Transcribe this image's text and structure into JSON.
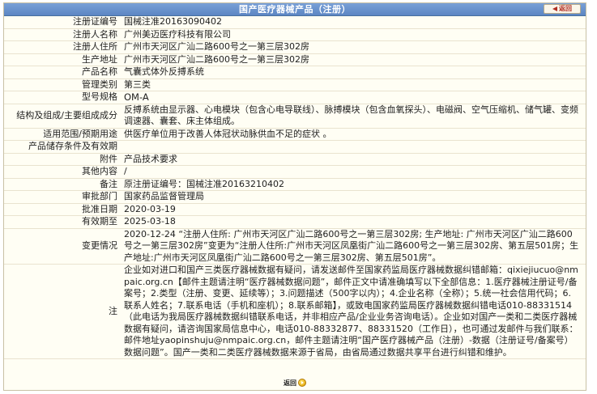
{
  "header": {
    "title": "国产医疗器械产品（注册）",
    "back_label": "返回"
  },
  "rows": [
    {
      "label": "注册证编号",
      "value": "国械注准20163090402"
    },
    {
      "label": "注册人名称",
      "value": "广州美迈医疗科技有限公司"
    },
    {
      "label": "注册人住所",
      "value": "广州市天河区广汕二路600号之一第三层302房"
    },
    {
      "label": "生产地址",
      "value": "广州市天河区广汕二路600号之一第三层302房"
    },
    {
      "label": "产品名称",
      "value": "气囊式体外反搏系统"
    },
    {
      "label": "管理类别",
      "value": "第三类"
    },
    {
      "label": "型号规格",
      "value": "OM-A"
    },
    {
      "label": "结构及组成/主要组成成分",
      "value": "反搏系统由显示器、心电模块（包含心电导联线）、脉搏模块（包含血氧探头）、电磁阀、空气压缩机、储气罐、变频调速器、囊套、床主体组成。"
    },
    {
      "label": "适用范围/预期用途",
      "value": "供医疗单位用于改善人体冠状动脉供血不足的症状 。"
    },
    {
      "label": "产品储存条件及有效期",
      "value": ""
    },
    {
      "label": "附件",
      "value": "产品技术要求"
    },
    {
      "label": "其他内容",
      "value": "/"
    },
    {
      "label": "备注",
      "value": "原注册证编号：国械注准20163210402"
    },
    {
      "label": "审批部门",
      "value": "国家药品监督管理局"
    },
    {
      "label": "批准日期",
      "value": "2020-03-19"
    },
    {
      "label": "有效期至",
      "value": "2025-03-18"
    },
    {
      "label": "变更情况",
      "value": "2020-12-24 “注册人住所: 广州市天河区广汕二路600号之一第三层302房; 生产地址: 广州市天河区广汕二路600号之一第三层302房”变更为“注册人住所:广州市天河区凤凰街广汕二路600号之一第三层302房、第五层501房；生产地址:广州市天河区凤凰街广汕二路600号之一第三层302房、第五层501房”。"
    },
    {
      "label": "注",
      "value": "企业如对进口和国产三类医疗器械数据有疑问，请发送邮件至国家药监局医疗器械数据纠错邮箱：qixiejiucuo@nmpaic.org.cn【邮件主题请注明“医疗器械数据问题”，邮件正文中请准确填写以下全部信息：1.医疗器械注册证号/备案号；2.类型（注册、变更、延续等）；3.问题描述（500字以内）；4.企业名称（全称）；5.统一社会信用代码；6.联系人姓名；7.联系电话（手机和座机）；8.联系邮箱】，或致电国家药监局医疗器械数据纠错电话010-88331514（此电话为我局医疗器械数据纠错联系电话，并非相应产品/企业业务咨询电话）。企业如对国产一类和二类医疗器械数据有疑问，请咨询国家局信息中心，电话010-88332877、88331520（工作日），也可通过发邮件与我们联系：邮件地址yaopinshuju@nmpaic.org.cn，邮件主题请注明“国产医疗器械产品（注册）-数据（注册证号/备案号）数据问题”。国产一类和二类医疗器械数据来源于省局，由省局通过数据共享平台进行纠错和维护。"
    }
  ],
  "footer": {
    "back_label": "返回"
  }
}
